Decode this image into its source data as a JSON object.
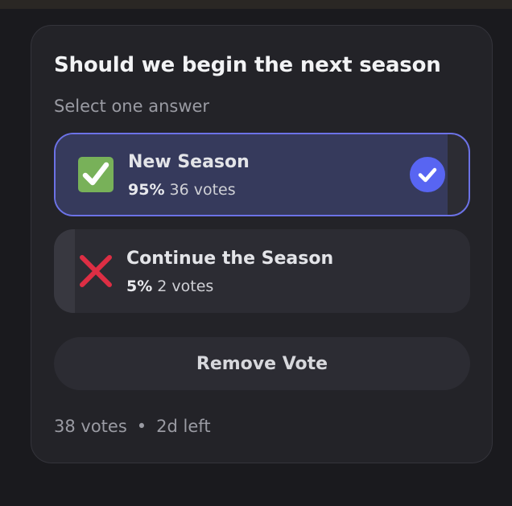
{
  "poll": {
    "question": "Should we begin the next season",
    "instructions": "Select one answer",
    "answers": [
      {
        "label": "New Season",
        "percent": "95%",
        "votes": "36 votes",
        "fraction": 0.95,
        "emoji": "white-check-mark-emoji",
        "selected": true
      },
      {
        "label": "Continue the Season",
        "percent": "5%",
        "votes": "2 votes",
        "fraction": 0.05,
        "emoji": "cross-mark-emoji",
        "selected": false
      }
    ],
    "remove_vote_label": "Remove Vote",
    "footer": {
      "total_votes": "38 votes",
      "separator": "•",
      "time_left": "2d left"
    }
  },
  "colors": {
    "background": "#1a1a1e",
    "card": "#232328",
    "selected_border": "#6c72e6",
    "selected_fill": "#363a5c",
    "accent": "#5865f2",
    "check_emoji_green": "#78b159",
    "cross_emoji_red": "#dd2e44"
  }
}
